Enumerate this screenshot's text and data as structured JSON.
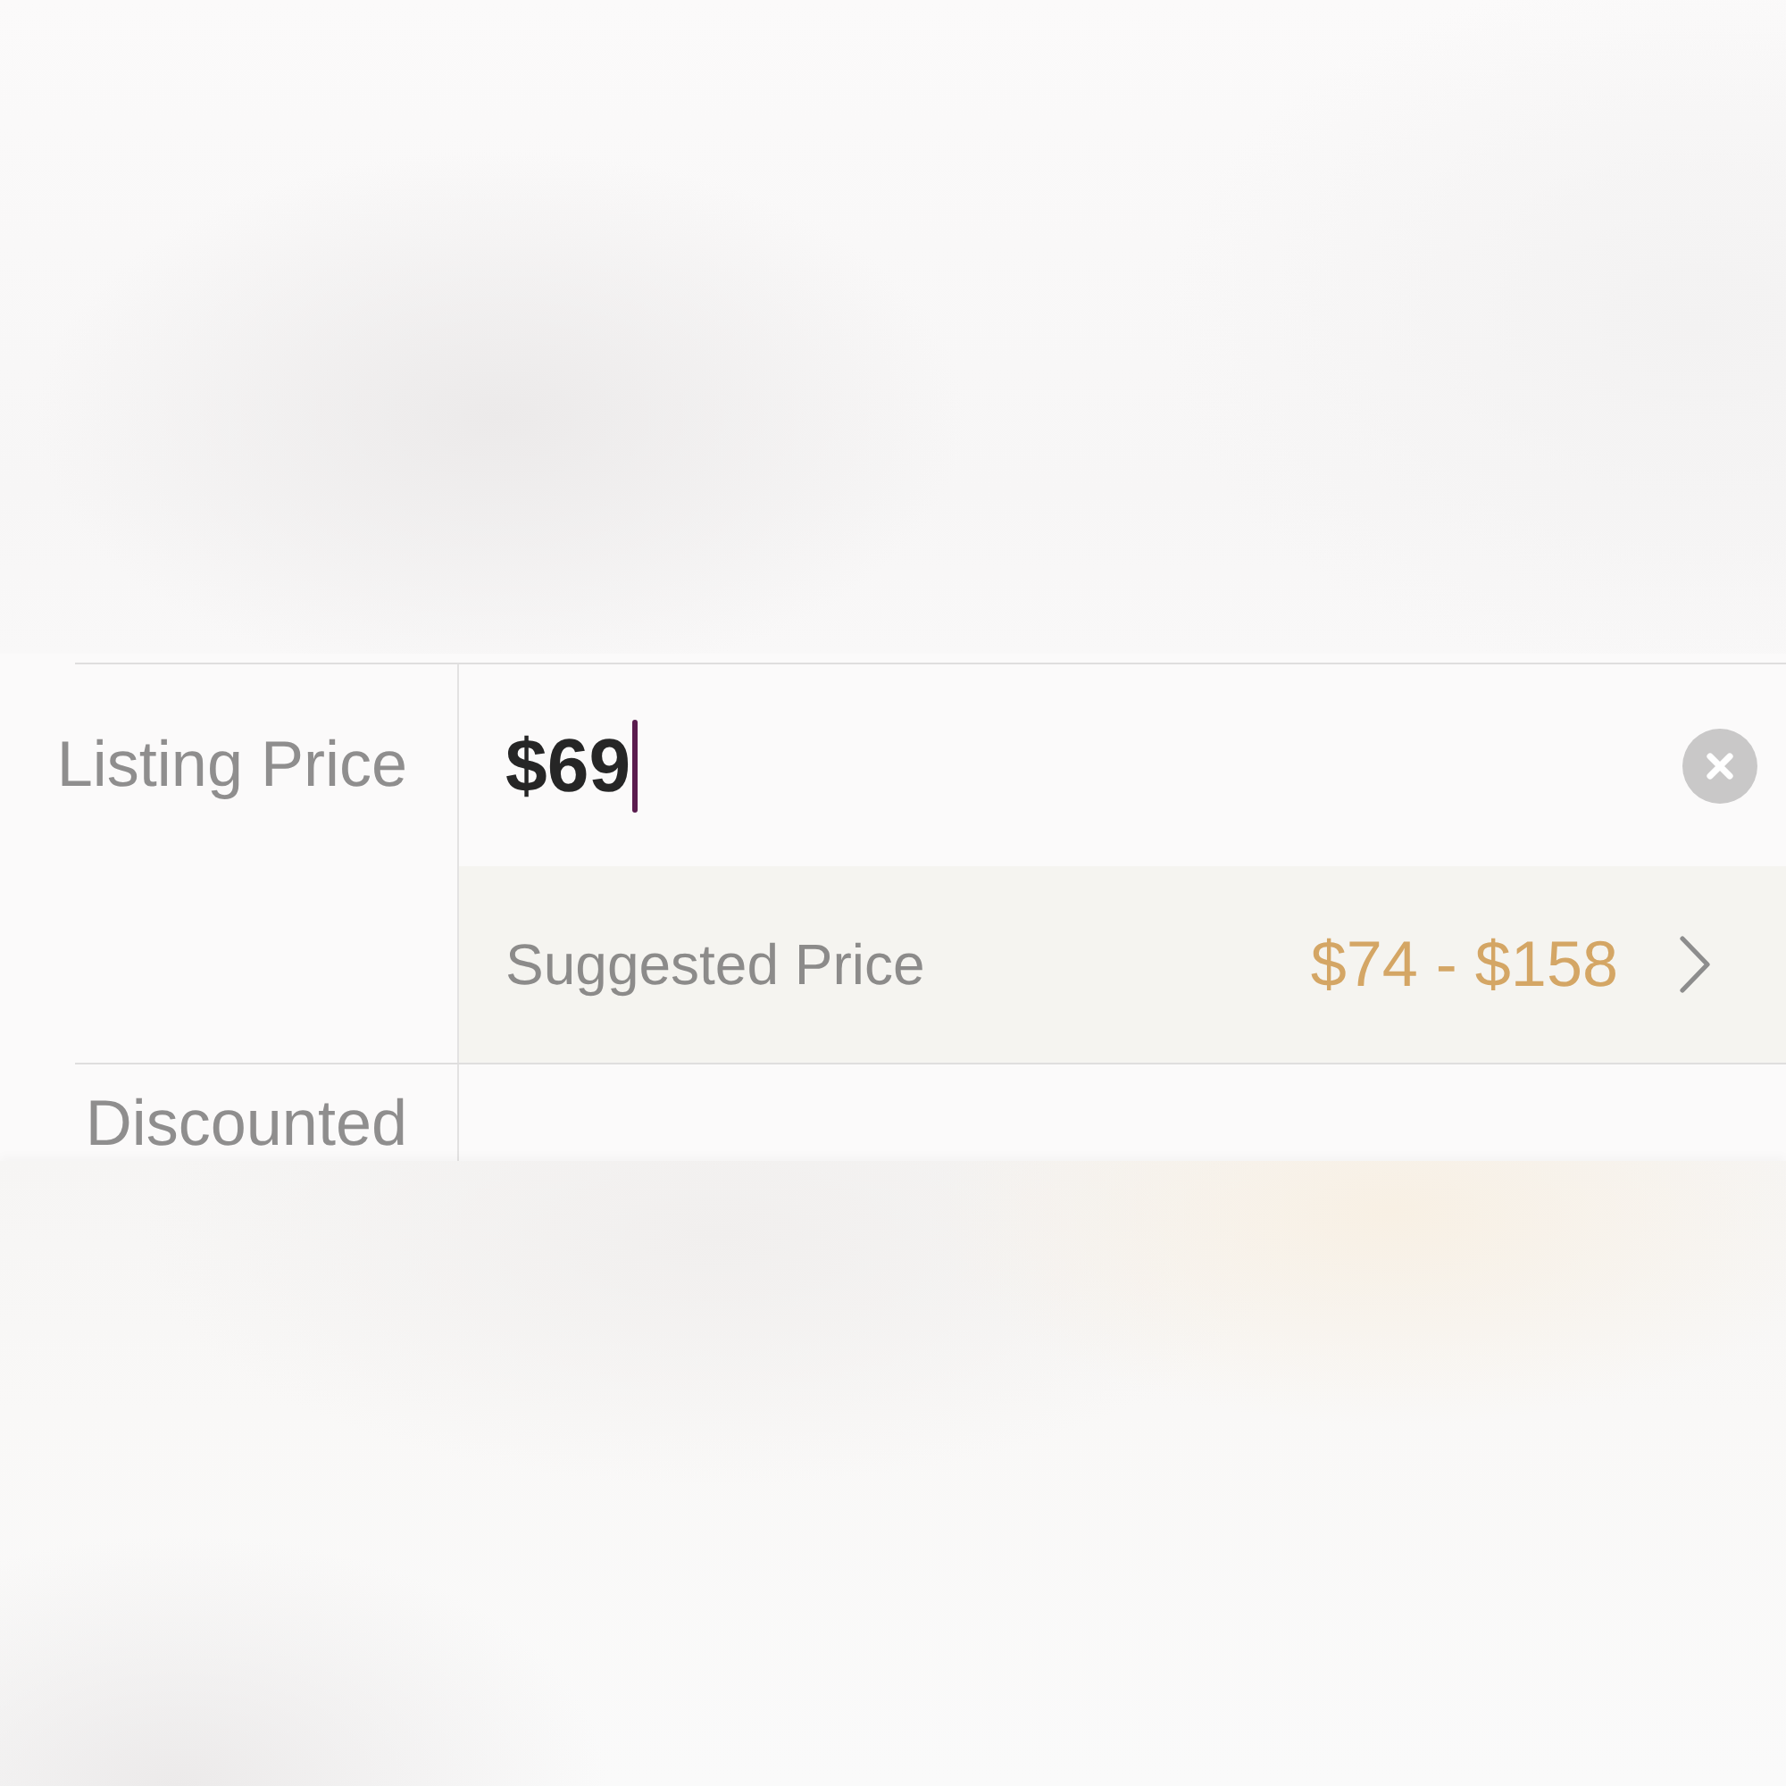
{
  "fields": [
    {
      "label": "Listing Price",
      "value": "$69",
      "focused": true,
      "suggestion": {
        "label": "Suggested Price",
        "range": "$74 - $158"
      }
    },
    {
      "label": "Discounted"
    }
  ]
}
